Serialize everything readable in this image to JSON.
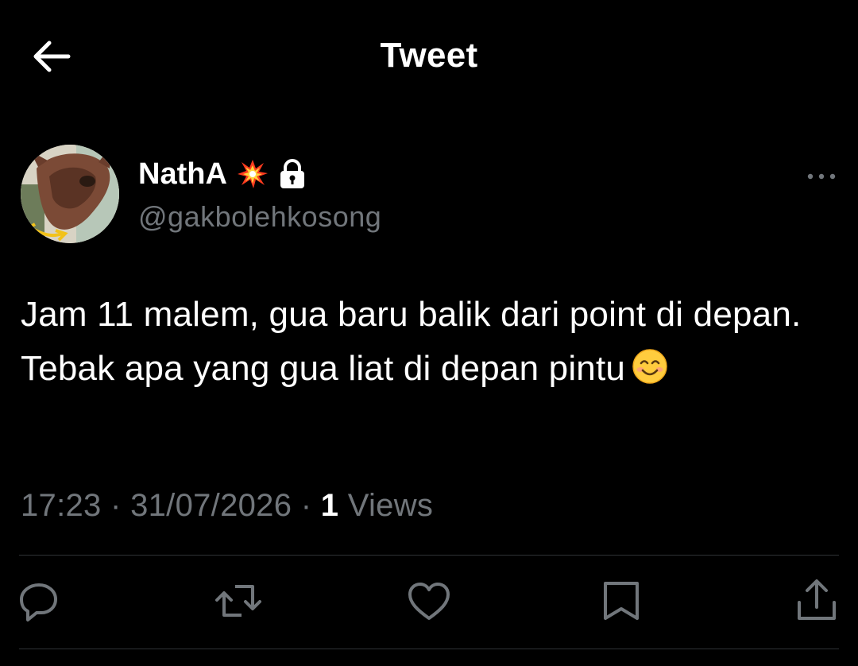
{
  "header": {
    "title": "Tweet",
    "back_icon": "arrow-left-icon"
  },
  "author": {
    "display_name": "NathA",
    "handle": "@gakbolehkosong",
    "name_emoji": "collision-emoji",
    "protected_icon": "lock-icon",
    "more_icon": "more-horizontal-icon"
  },
  "tweet": {
    "text": "Jam 11 malem, gua baru balik dari point di depan. Tebak apa yang gua liat di depan pintu",
    "emoji": "smiling-face-emoji"
  },
  "meta": {
    "time": "17:23",
    "date": "31/07/2026",
    "separator": "·",
    "views_count": "1",
    "views_label": "Views"
  },
  "actions": [
    {
      "name": "reply",
      "icon": "reply-icon"
    },
    {
      "name": "retweet",
      "icon": "retweet-icon"
    },
    {
      "name": "like",
      "icon": "heart-icon"
    },
    {
      "name": "bookmark",
      "icon": "bookmark-icon"
    },
    {
      "name": "share",
      "icon": "share-icon"
    }
  ],
  "colors": {
    "background": "#000000",
    "text_primary": "#ffffff",
    "text_secondary": "#71767b",
    "divider": "#2f3336"
  }
}
